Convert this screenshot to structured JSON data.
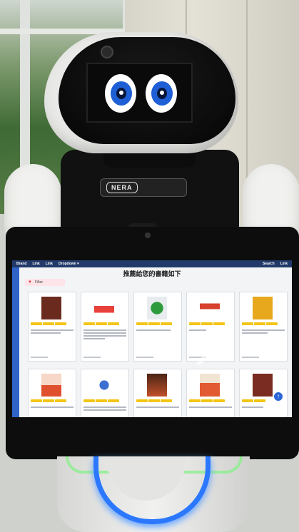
{
  "photo": {
    "robot_brand": "NERA",
    "tablet": {
      "topbar": [
        "Brand",
        "Link",
        "Link",
        "Dropdown ▾",
        "Search",
        "Link"
      ],
      "page_title": "推薦給您的書籍如下",
      "filter_label": "Filter",
      "back_to_top_icon": "arrow-up-icon"
    },
    "colors": {
      "eye_iris": "#1f5fd6",
      "ring_light": "#2b78ff",
      "topbar": "#223a6a",
      "tag": "#f3c515"
    }
  }
}
